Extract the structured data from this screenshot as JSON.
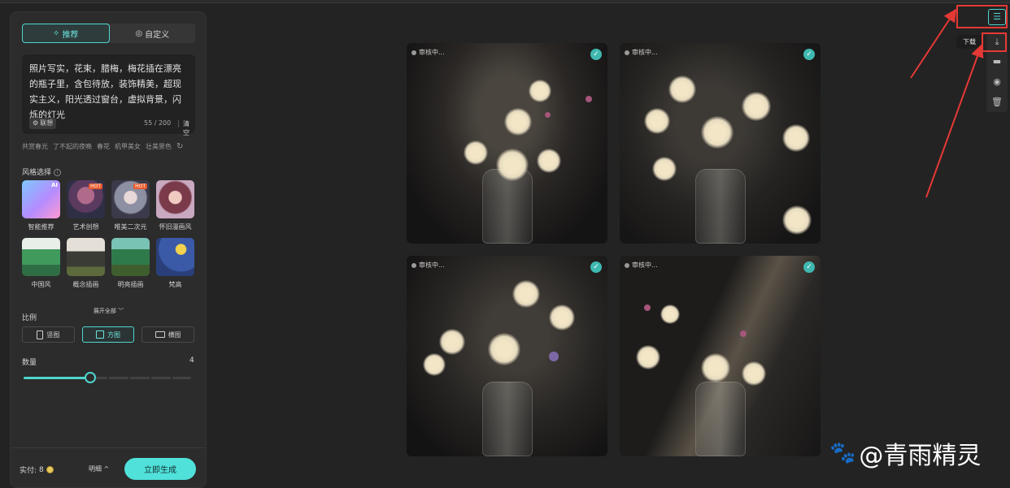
{
  "mode_tabs": {
    "recommend": "推荐",
    "custom": "自定义",
    "recommend_icon": "✧",
    "custom_icon": "◎"
  },
  "prompt": {
    "text": "照片写实，花束，腊梅，梅花插在漂亮的瓶子里，含包待放，装饰精美，超现实主义，阳光透过窗台，虚拟背景，闪烁的灯光",
    "assoc_label": "联想",
    "count": "55 / 200",
    "clear_label": "清空"
  },
  "suggestions": [
    "共赏春光",
    "了不起的夜晚",
    "春花",
    "机甲美女",
    "壮美景色"
  ],
  "style_section": {
    "label": "风格选择"
  },
  "styles": [
    {
      "label": "智能推荐",
      "badge": "AI"
    },
    {
      "label": "艺术创想",
      "badge": "HOT"
    },
    {
      "label": "唯美二次元",
      "badge": "HOT"
    },
    {
      "label": "怀旧漫画风",
      "badge": ""
    },
    {
      "label": "中国风",
      "badge": ""
    },
    {
      "label": "概念插画",
      "badge": ""
    },
    {
      "label": "明亮插画",
      "badge": ""
    },
    {
      "label": "梵高",
      "badge": ""
    }
  ],
  "expand_label": "展开全部 ﹀",
  "ratio": {
    "label": "比例",
    "options": [
      "竖图",
      "方图",
      "横图"
    ],
    "selected": "方图"
  },
  "quantity": {
    "label": "数量",
    "value": "4",
    "level": 0.4
  },
  "footer": {
    "cost_label": "实付:",
    "cost_value": "8",
    "detail_label": "明细 ^",
    "generate_label": "立即生成"
  },
  "results": [
    {
      "status": "审核中..."
    },
    {
      "status": "审核中..."
    },
    {
      "status": "审核中..."
    },
    {
      "status": "审核中..."
    }
  ],
  "toolbar": {
    "download_tooltip": "下载",
    "icons": [
      "download-icon",
      "folder-icon",
      "eye-icon",
      "trash-icon"
    ]
  },
  "watermark": {
    "text": "@青雨精灵"
  },
  "colors": {
    "accent": "#4fd6d0",
    "annotation": "#e53935",
    "background": "#232323",
    "panel": "#2c2c2c"
  }
}
